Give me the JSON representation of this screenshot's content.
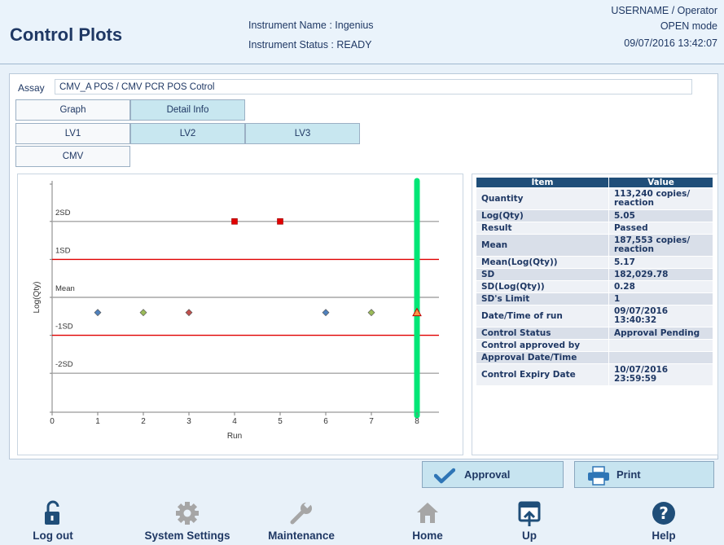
{
  "header": {
    "title": "Control Plots",
    "instrument_name": "Instrument Name : Ingenius",
    "instrument_status": "Instrument Status : READY",
    "user": "USERNAME / Operator",
    "mode": "OPEN mode",
    "datetime": "09/07/2016 13:42:07"
  },
  "assay": {
    "label": "Assay",
    "value": "CMV_A POS / CMV PCR POS Cotrol"
  },
  "tabs": {
    "graph": "Graph",
    "detail_info": "Detail Info",
    "lv1": "LV1",
    "lv2": "LV2",
    "lv3": "LV3",
    "cmv": "CMV"
  },
  "chart_data": {
    "type": "scatter",
    "xlabel": "Run",
    "ylabel": "Log(Qty)",
    "xlim": [
      0,
      8.5
    ],
    "x_ticks": [
      0,
      1,
      2,
      3,
      4,
      5,
      6,
      7,
      8
    ],
    "reference_lines": [
      {
        "label": "2SD",
        "sd": 2,
        "color": "#a6a6a6"
      },
      {
        "label": "1SD",
        "sd": 1,
        "color": "#e00000"
      },
      {
        "label": "Mean",
        "sd": 0,
        "color": "#a6a6a6"
      },
      {
        "label": "-1SD",
        "sd": -1,
        "color": "#e00000"
      },
      {
        "label": "-2SD",
        "sd": -2,
        "color": "#a6a6a6"
      }
    ],
    "points": [
      {
        "x": 1,
        "sd": -0.4,
        "shape": "diamond",
        "color": "#4f81bd"
      },
      {
        "x": 2,
        "sd": -0.4,
        "shape": "diamond",
        "color": "#9bbb59"
      },
      {
        "x": 3,
        "sd": -0.4,
        "shape": "diamond",
        "color": "#c0504d"
      },
      {
        "x": 4,
        "sd": 2.0,
        "shape": "square",
        "color": "#e00000"
      },
      {
        "x": 5,
        "sd": 2.0,
        "shape": "square",
        "color": "#e00000"
      },
      {
        "x": 6,
        "sd": -0.4,
        "shape": "diamond",
        "color": "#4f81bd"
      },
      {
        "x": 7,
        "sd": -0.4,
        "shape": "diamond",
        "color": "#9bbb59"
      },
      {
        "x": 8,
        "sd": -0.4,
        "shape": "triangle",
        "color": "#f79646"
      }
    ],
    "highlight_run": 8,
    "highlight_color": "#00e676"
  },
  "info_table": {
    "col_item": "Item",
    "col_value": "Value",
    "rows": [
      {
        "item": "Quantity",
        "value": "113,240 copies/ reaction"
      },
      {
        "item": "Log(Qty)",
        "value": "5.05"
      },
      {
        "item": "Result",
        "value": "Passed"
      },
      {
        "item": "Mean",
        "value": "187,553 copies/ reaction"
      },
      {
        "item": "Mean(Log(Qty))",
        "value": "5.17"
      },
      {
        "item": "SD",
        "value": "182,029.78"
      },
      {
        "item": "SD(Log(Qty))",
        "value": "0.28"
      },
      {
        "item": "SD's Limit",
        "value": "1"
      },
      {
        "item": "Date/Time of run",
        "value": "09/07/2016 13:40:32"
      },
      {
        "item": "Control Status",
        "value": "Approval Pending"
      },
      {
        "item": "Control approved by",
        "value": ""
      },
      {
        "item": "Approval Date/Time",
        "value": ""
      },
      {
        "item": "Control Expiry Date",
        "value": "10/07/2016 23:59:59"
      }
    ]
  },
  "buttons": {
    "approval": "Approval",
    "print": "Print"
  },
  "bottom_bar": {
    "logout": "Log out",
    "system_settings": "System Settings",
    "maintenance": "Maintenance",
    "home": "Home",
    "up": "Up",
    "help": "Help"
  },
  "colors": {
    "accent_dark": "#1f4e79",
    "tab_selected": "#c8e7f0",
    "icon_blue": "#1f4e79",
    "icon_gray": "#a6a6a6"
  }
}
